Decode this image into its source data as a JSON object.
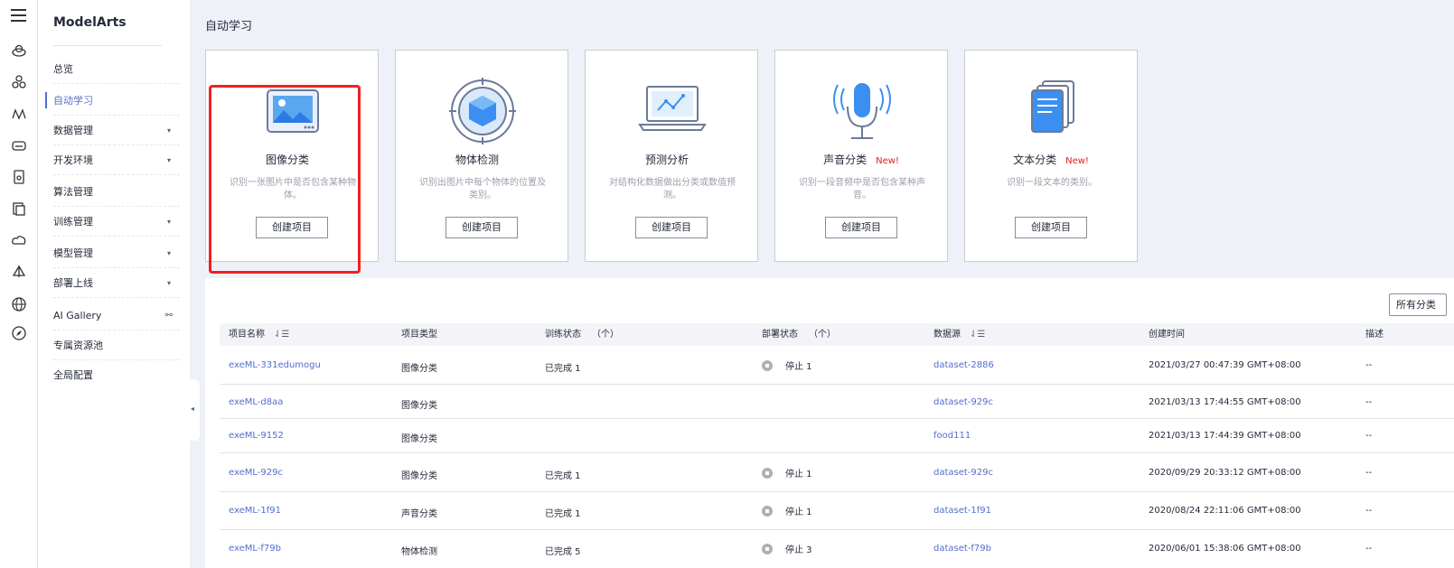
{
  "brand": "ModelArts",
  "nav": [
    {
      "label": "总览",
      "suffix": ""
    },
    {
      "label": "自动学习",
      "suffix": ""
    },
    {
      "label": "数据管理",
      "suffix": "▾"
    },
    {
      "label": "开发环境",
      "suffix": "▾"
    },
    {
      "label": "算法管理",
      "suffix": ""
    },
    {
      "label": "训练管理",
      "suffix": "▾"
    },
    {
      "label": "模型管理",
      "suffix": "▾"
    },
    {
      "label": "部署上线",
      "suffix": "▾"
    },
    {
      "label": "AI Gallery",
      "suffix": "⚯"
    },
    {
      "label": "专属资源池",
      "suffix": ""
    },
    {
      "label": "全局配置",
      "suffix": ""
    }
  ],
  "page_title": "自动学习",
  "cards": [
    {
      "title": "图像分类",
      "new": "",
      "desc": "识别一张图片中是否包含某种物体。",
      "button": "创建项目",
      "icon": "image-classification-icon"
    },
    {
      "title": "物体检测",
      "new": "",
      "desc": "识别出图片中每个物体的位置及类别。",
      "button": "创建项目",
      "icon": "object-detection-icon"
    },
    {
      "title": "预测分析",
      "new": "",
      "desc": "对结构化数据做出分类或数值预测。",
      "button": "创建项目",
      "icon": "predictive-analysis-icon"
    },
    {
      "title": "声音分类",
      "new": "New!",
      "desc": "识别一段音频中是否包含某种声音。",
      "button": "创建项目",
      "icon": "sound-classification-icon"
    },
    {
      "title": "文本分类",
      "new": "New!",
      "desc": "识别一段文本的类别。",
      "button": "创建项目",
      "icon": "text-classification-icon"
    }
  ],
  "filter_label": "所有分类",
  "table": {
    "headers": {
      "name": "项目名称",
      "type": "项目类型",
      "train": "训练状态",
      "train_unit": "（个）",
      "deploy": "部署状态",
      "deploy_unit": "（个）",
      "dataset": "数据源",
      "created": "创建时间",
      "desc": "描述",
      "sort_icon": "⇃☰"
    },
    "rows": [
      {
        "name": "exeML-331edumogu",
        "type": "图像分类",
        "train": "已完成 1",
        "deploy": "停止 1",
        "dataset": "dataset-2886",
        "created": "2021/03/27 00:47:39 GMT+08:00",
        "desc": "--"
      },
      {
        "name": "exeML-d8aa",
        "type": "图像分类",
        "train": "",
        "deploy": "",
        "dataset": "dataset-929c",
        "created": "2021/03/13 17:44:55 GMT+08:00",
        "desc": "--"
      },
      {
        "name": "exeML-9152",
        "type": "图像分类",
        "train": "",
        "deploy": "",
        "dataset": "food111",
        "created": "2021/03/13 17:44:39 GMT+08:00",
        "desc": "--"
      },
      {
        "name": "exeML-929c",
        "type": "图像分类",
        "train": "已完成 1",
        "deploy": "停止 1",
        "dataset": "dataset-929c",
        "created": "2020/09/29 20:33:12 GMT+08:00",
        "desc": "--"
      },
      {
        "name": "exeML-1f91",
        "type": "声音分类",
        "train": "已完成 1",
        "deploy": "停止 1",
        "dataset": "dataset-1f91",
        "created": "2020/08/24 22:11:06 GMT+08:00",
        "desc": "--"
      },
      {
        "name": "exeML-f79b",
        "type": "物体检测",
        "train": "已完成 5",
        "deploy": "停止 3",
        "dataset": "dataset-f79b",
        "created": "2020/06/01 15:38:06 GMT+08:00",
        "desc": "--"
      }
    ]
  }
}
